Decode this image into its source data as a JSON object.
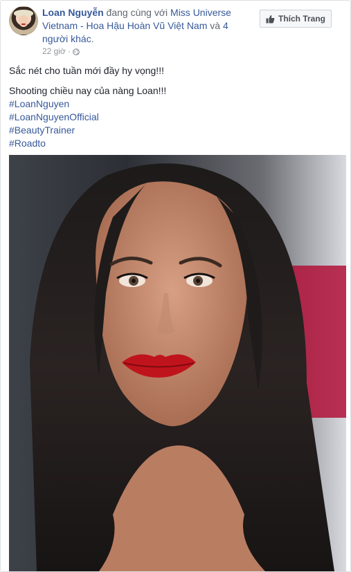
{
  "post": {
    "author": "Loan Nguyễn",
    "with_text": " đang cùng với ",
    "tagged_page": "Miss Universe Vietnam - Hoa Hậu Hoàn Vũ Việt Nam",
    "and_text": " và ",
    "others": "4 người khác",
    "trailing_dot": ".",
    "time": "22 giờ",
    "dot_separator": "·",
    "privacy_icon": "globe-icon",
    "like_page_label": "Thích Trang",
    "like_icon": "thumbs-up-icon",
    "lines": [
      "Sắc nét cho tuần mới đầy hy vọng!!!",
      "Shooting chiều nay của nàng Loan!!!"
    ],
    "hashtags": [
      "#LoanNguyen",
      "#LoanNguyenOfficial",
      "#BeautyTrainer",
      "#Roadto"
    ]
  },
  "colors": {
    "link": "#365899",
    "meta": "#90949c",
    "text": "#1d2129",
    "button_bg": "#f6f7f9",
    "lip_red": "#c0141c"
  }
}
